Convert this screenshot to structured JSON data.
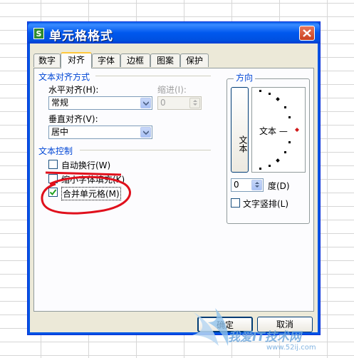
{
  "dialog": {
    "title": "单元格格式",
    "app_icon_text": "S",
    "tabs": [
      {
        "label": "数字"
      },
      {
        "label": "对齐"
      },
      {
        "label": "字体"
      },
      {
        "label": "边框"
      },
      {
        "label": "图案"
      },
      {
        "label": "保护"
      }
    ],
    "active_tab": "对齐"
  },
  "alignment": {
    "section_title": "文本对齐方式",
    "horizontal_label": "水平对齐(H):",
    "horizontal_value": "常规",
    "indent_label": "缩进(I):",
    "indent_value": "0",
    "vertical_label": "垂直对齐(V):",
    "vertical_value": "居中"
  },
  "text_control": {
    "section_title": "文本控制",
    "wrap_label": "自动换行(W)",
    "shrink_label": "缩小字体填充(K)",
    "merge_label": "合并单元格(M)",
    "merge_checked": true
  },
  "orientation": {
    "section_title": "方向",
    "vertical_text_button": "文本",
    "dial_text": "文本 —",
    "degree_value": "0",
    "degree_label": "度(D)",
    "stacked_label": "文字竖排(L)"
  },
  "buttons": {
    "ok": "确定",
    "cancel": "取消"
  },
  "watermark": {
    "text": "我爱IT技术网",
    "url": "www.52ij.com"
  },
  "colors": {
    "annotation_red": "#e0101c",
    "title_bar_blue": "#0058ee",
    "accent_orange": "#ffc83c"
  }
}
